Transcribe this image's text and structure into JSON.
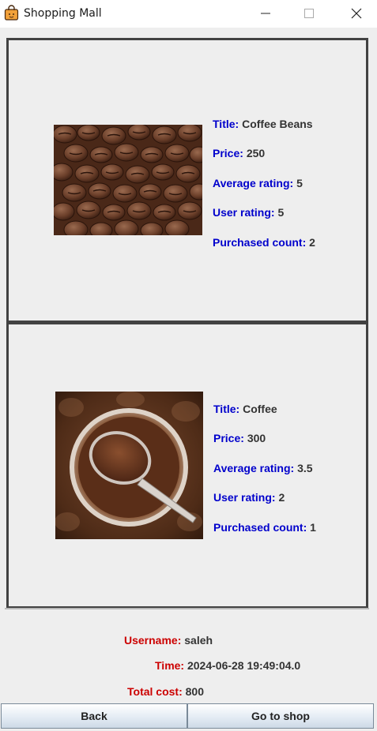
{
  "window": {
    "title": "Shopping Mall",
    "icons": {
      "app": "shopping-bag-icon",
      "minimize": "minimize-icon",
      "maximize": "maximize-icon",
      "close": "close-icon"
    }
  },
  "products": [
    {
      "image": "coffee-beans-photo",
      "title_label": "Title:",
      "title": "Coffee Beans",
      "price_label": "Price:",
      "price": "250",
      "avg_rating_label": "Average rating:",
      "avg_rating": "5",
      "user_rating_label": "User rating:",
      "user_rating": "5",
      "purchased_label": "Purchased count:",
      "purchased": "2"
    },
    {
      "image": "ground-coffee-spoon-photo",
      "title_label": "Title:",
      "title": "Coffee",
      "price_label": "Price:",
      "price": "300",
      "avg_rating_label": "Average rating:",
      "avg_rating": "3.5",
      "user_rating_label": "User rating:",
      "user_rating": "2",
      "purchased_label": "Purchased count:",
      "purchased": "1"
    }
  ],
  "summary": {
    "username_label": "Username:",
    "username": "saleh",
    "time_label": "Time:",
    "time": "2024-06-28 19:49:04.0",
    "total_label": "Total cost:",
    "total": "800"
  },
  "buttons": {
    "back": "Back",
    "shop": "Go to shop"
  },
  "colors": {
    "label_blue": "#0000cc",
    "label_red": "#cc0000",
    "panel_border": "#424242",
    "background": "#eeeeee"
  }
}
